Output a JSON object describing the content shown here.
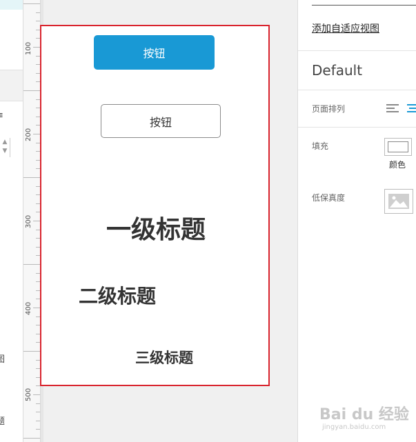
{
  "ruler": {
    "labels": [
      "100",
      "200",
      "300",
      "400",
      "500"
    ]
  },
  "left_panel": {
    "glyph_1": "≡",
    "glyph_2": "图",
    "glyph_3": "题"
  },
  "canvas": {
    "primary_button_label": "按钮",
    "outline_button_label": "按钮",
    "heading_1": "一级标题",
    "heading_2": "二级标题",
    "heading_3": "三级标题"
  },
  "inspector": {
    "adaptive_view_link": "添加自适应视图",
    "view_name": "Default",
    "page_arrangement_label": "页面排列",
    "fill_label": "填充",
    "fill_color_caption": "颜色",
    "low_fidelity_label": "低保真度"
  },
  "watermark": {
    "brand": "Bai du 经验",
    "url": "jingyan.baidu.com"
  },
  "colors": {
    "primary": "#1999d5",
    "frame": "#d9232d",
    "align_active": "#1999d5"
  }
}
